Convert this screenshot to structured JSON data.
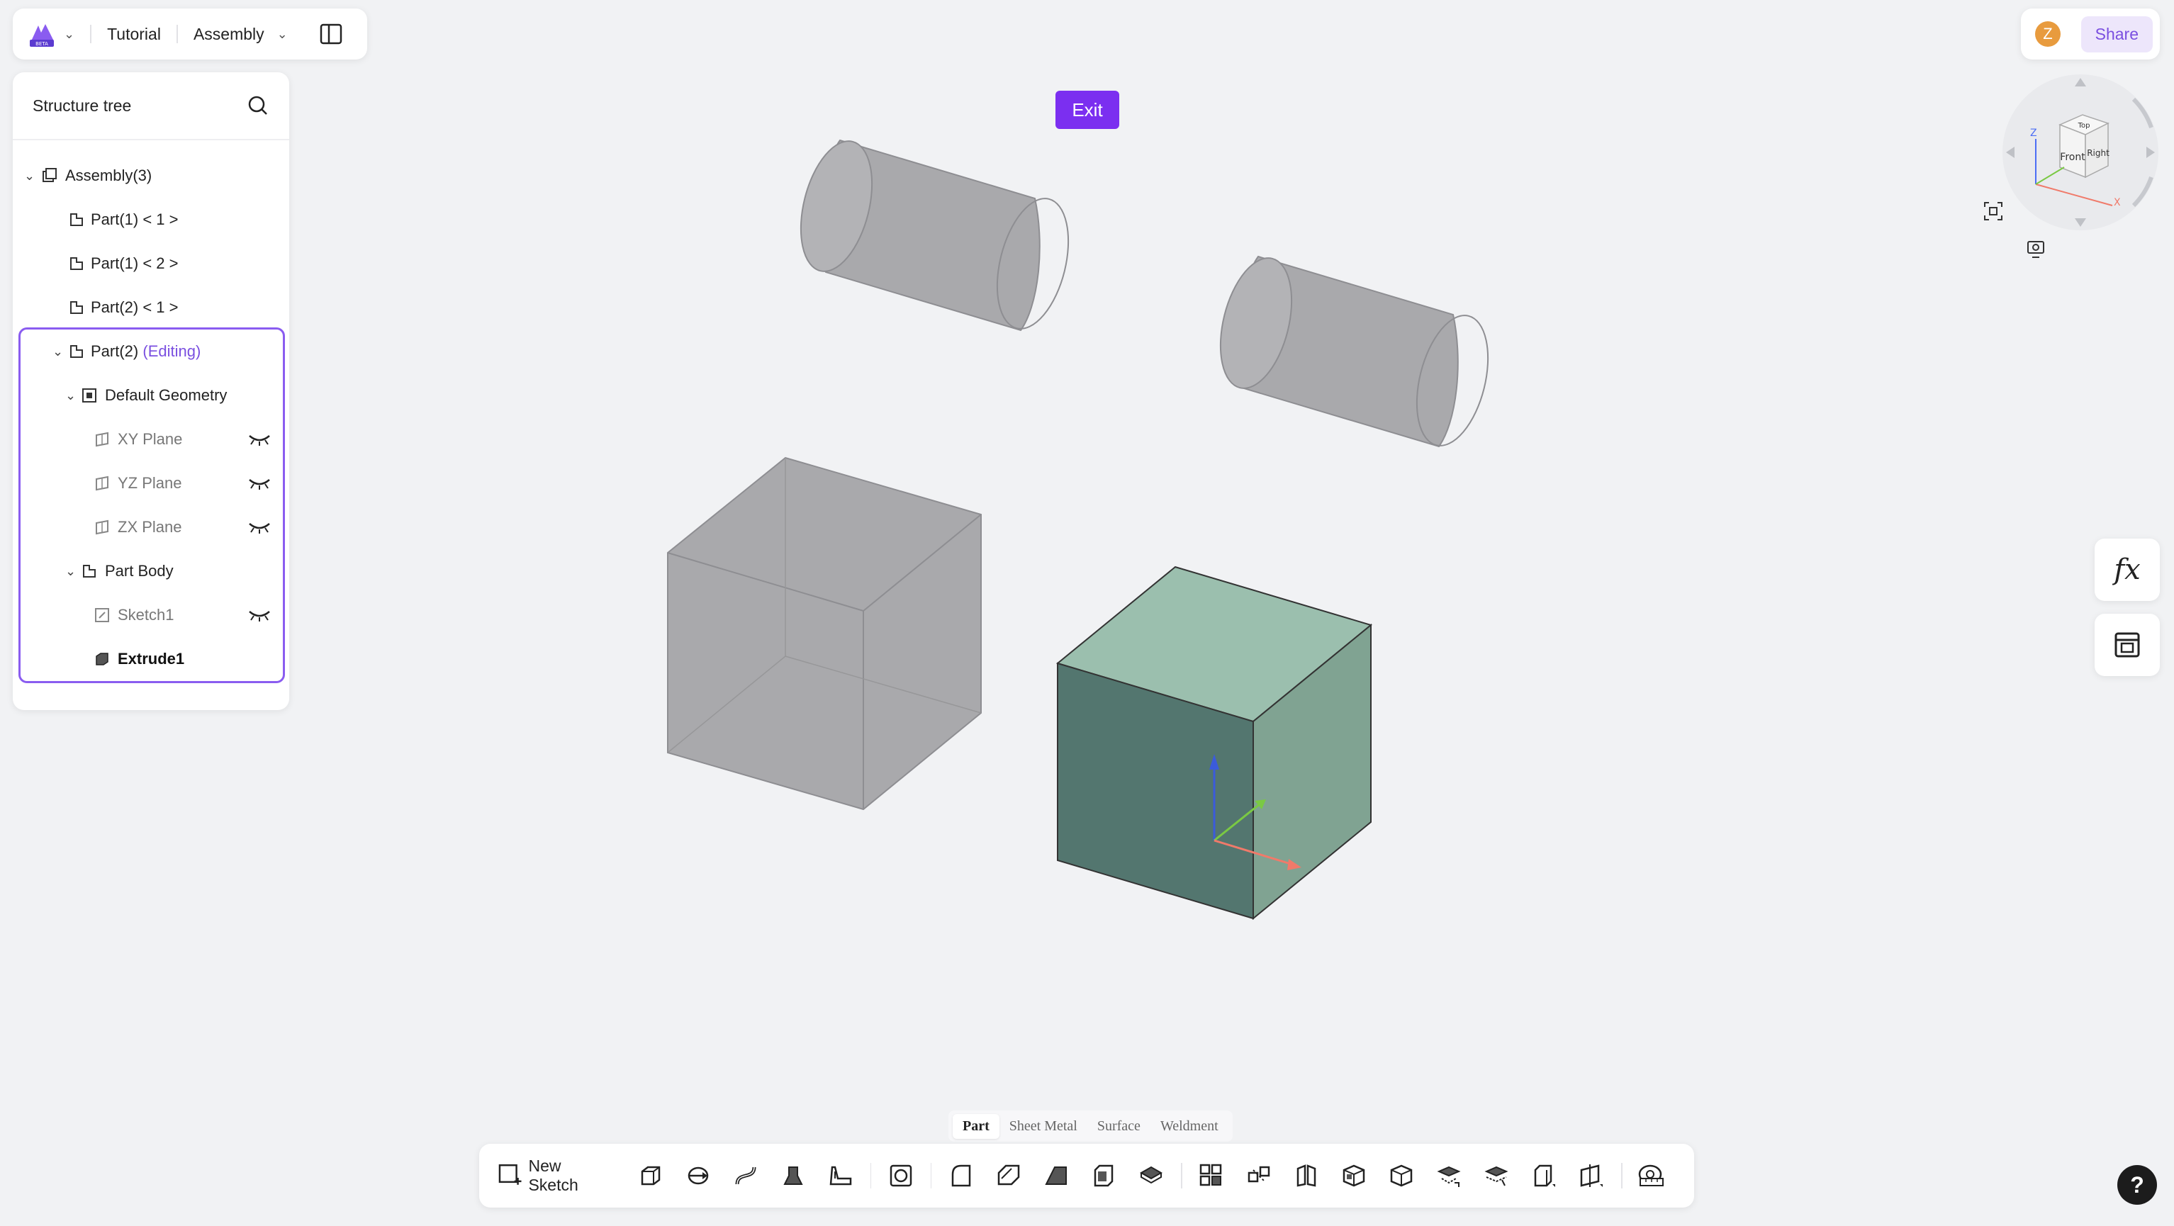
{
  "topbar": {
    "project": "Tutorial",
    "mode": "Assembly"
  },
  "user": {
    "initial": "Z",
    "share_label": "Share"
  },
  "tree": {
    "title": "Structure tree",
    "items": [
      {
        "label": "Assembly(3)"
      },
      {
        "label": "Part(1) < 1 >"
      },
      {
        "label": "Part(1) < 2 >"
      },
      {
        "label": "Part(2) < 1 >"
      },
      {
        "label": "Part(2)",
        "badge": "(Editing)"
      },
      {
        "label": "Default Geometry"
      },
      {
        "label": "XY Plane"
      },
      {
        "label": "YZ Plane"
      },
      {
        "label": "ZX Plane"
      },
      {
        "label": "Part Body"
      },
      {
        "label": "Sketch1"
      },
      {
        "label": "Extrude1"
      }
    ]
  },
  "exit_label": "Exit",
  "viewcube": {
    "faces": [
      "Top",
      "Front",
      "Right"
    ],
    "axes": [
      "Z",
      "X"
    ]
  },
  "fx_label": "fx",
  "mode_tabs": [
    "Part",
    "Sheet Metal",
    "Surface",
    "Weldment"
  ],
  "toolbar": {
    "new_sketch": "New Sketch"
  },
  "help_label": "?",
  "colors": {
    "accent": "#7b2ff0",
    "edit_border": "#8a5cf0",
    "ghost_body": "#aaaaad",
    "active_top": "#9bbfae",
    "active_front": "#53766f",
    "active_side": "#80a392"
  }
}
